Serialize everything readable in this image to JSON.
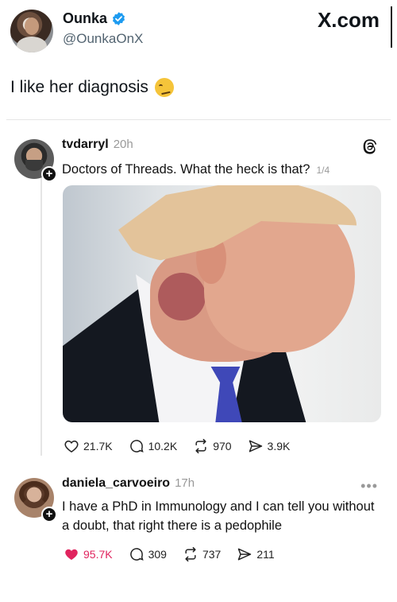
{
  "x_post": {
    "author_name": "Ounka",
    "author_handle": "@OunkaOnX",
    "brand": "X.com",
    "text": "I like her diagnosis"
  },
  "thread": {
    "post": {
      "username": "tvdarryl",
      "time": "20h",
      "text": "Doctors of Threads. What the heck is that?",
      "page_count": "1/4",
      "likes": "21.7K",
      "replies": "10.2K",
      "reposts": "970",
      "shares": "3.9K"
    },
    "reply": {
      "username": "daniela_carvoeiro",
      "time": "17h",
      "text": "I have a PhD in Immunology and I can tell you without a doubt, that right there is a pedophile",
      "likes": "95.7K",
      "replies": "309",
      "reposts": "737",
      "shares": "211"
    },
    "more_glyph": "•••"
  },
  "colors": {
    "verified_blue": "#1d9bf0",
    "liked_red": "#e0245e",
    "muted_gray": "#999999"
  }
}
